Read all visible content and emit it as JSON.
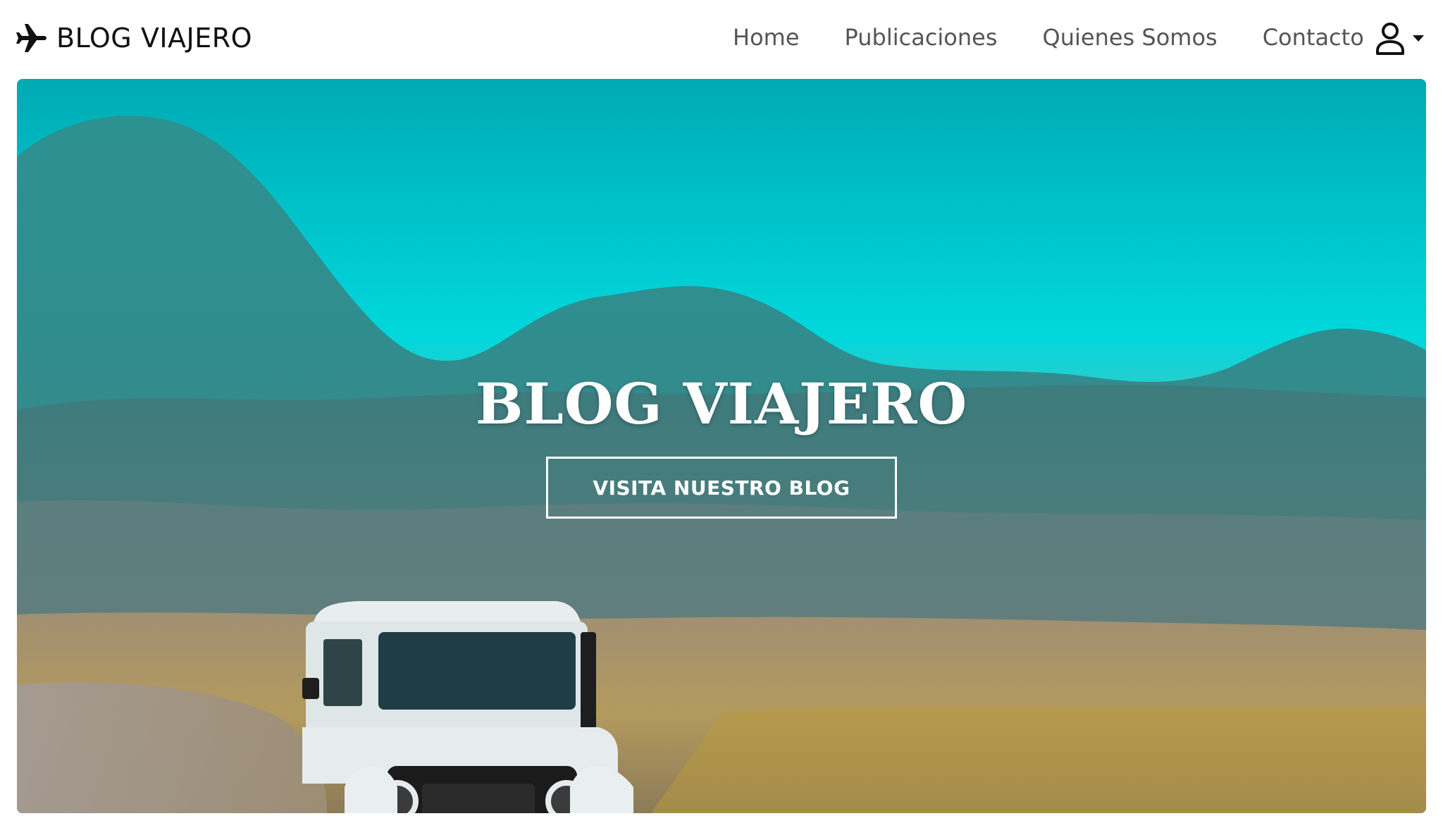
{
  "navbar": {
    "brand": "BLOG VIAJERO",
    "brand_icon": "airplane-icon",
    "links": [
      "Home",
      "Publicaciones",
      "Quienes Somos",
      "Contacto"
    ],
    "user_icon": "user-icon",
    "caret_icon": "caret-down-icon"
  },
  "hero": {
    "title": "BLOG VIAJERO",
    "cta": "VISITA NUESTRO BLOG"
  },
  "colors": {
    "sky": "#00d2d6",
    "mountain": "#3f7f85",
    "field": "#b49a5f",
    "text": "#ffffff"
  }
}
